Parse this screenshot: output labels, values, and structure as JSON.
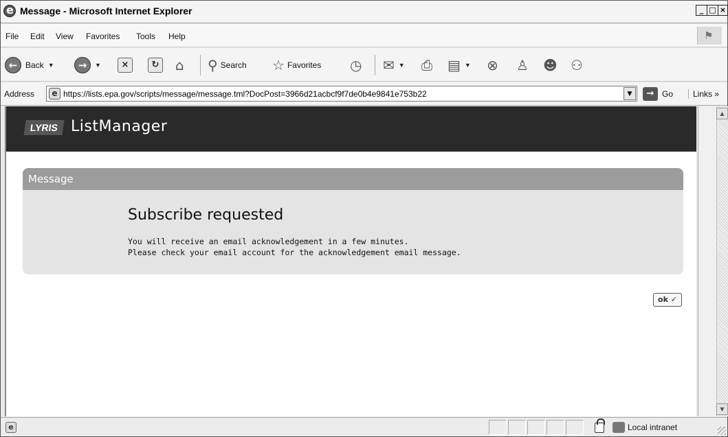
{
  "window": {
    "title": "Message - Microsoft Internet Explorer",
    "controls": {
      "minimize": "_",
      "maximize": "□",
      "close": "×"
    }
  },
  "menu": {
    "items": [
      "File",
      "Edit",
      "View",
      "Favorites",
      "Tools",
      "Help"
    ]
  },
  "toolbar": {
    "back_label": "Back",
    "search_label": "Search",
    "favorites_label": "Favorites",
    "icons": [
      "back-icon",
      "forward-icon",
      "stop-icon",
      "refresh-icon",
      "home-icon",
      "search-icon",
      "favorites-star-icon",
      "history-icon",
      "mail-icon",
      "print-icon",
      "edit-icon",
      "messenger-icon",
      "person-icon",
      "yahoo-icon",
      "people-icon"
    ]
  },
  "address": {
    "label": "Address",
    "url": "https://lists.epa.gov/scripts/message/message.tml?DocPost=3966d21acbcf9f7de0b4e9841e753b22",
    "go_label": "Go",
    "links_label": "Links",
    "links_chevron": "»"
  },
  "page": {
    "logo_text": "LYRIS",
    "app_name": "ListManager",
    "panel": {
      "header": "Message",
      "title": "Subscribe requested",
      "lines": [
        "You will receive an email acknowledgement in a few minutes.",
        "Please check your email account for the acknowledgement email message."
      ]
    },
    "ok_label": "ok ✓"
  },
  "status": {
    "zone": "Local intranet"
  },
  "colors": {
    "header_bg": "#2a2a2a",
    "panel_bg": "#e4e4e4",
    "panel_header_bg": "#9c9c9c"
  }
}
